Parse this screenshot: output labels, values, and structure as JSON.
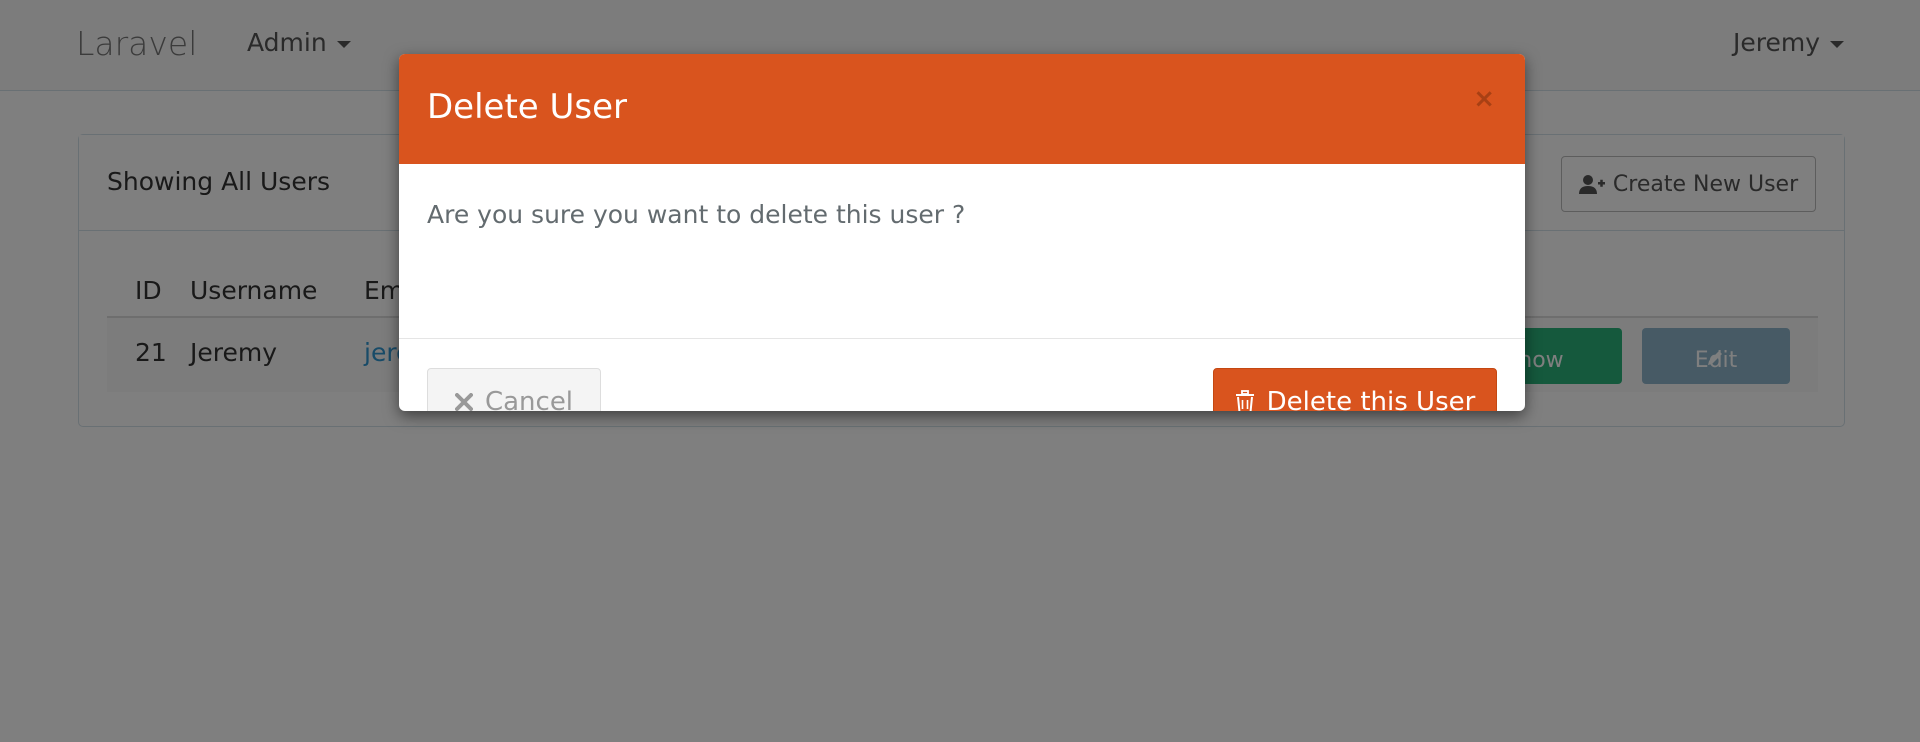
{
  "navbar": {
    "brand": "Laravel",
    "admin_menu": "Admin",
    "user_menu": "Jeremy"
  },
  "panel": {
    "title": "Showing All Users",
    "create_button": "Create New User",
    "table": {
      "headers": [
        "ID",
        "Username",
        "Em"
      ],
      "rows": [
        {
          "id": "21",
          "username": "Jeremy",
          "email": "jere",
          "show_label": "Show",
          "edit_label": "Edit"
        }
      ]
    }
  },
  "modal": {
    "title": "Delete User",
    "close_glyph": "×",
    "message": "Are you sure you want to delete this user ?",
    "cancel_label": "Cancel",
    "delete_label": "Delete this User"
  },
  "colors": {
    "modal_header": "#d9541e",
    "show_button": "#2ab27b",
    "edit_button": "#8eb4cb",
    "link": "#3097d1"
  },
  "icons": {
    "create": "user-plus-icon",
    "cancel": "times-icon",
    "delete": "trash-icon",
    "edit": "pencil-icon"
  }
}
